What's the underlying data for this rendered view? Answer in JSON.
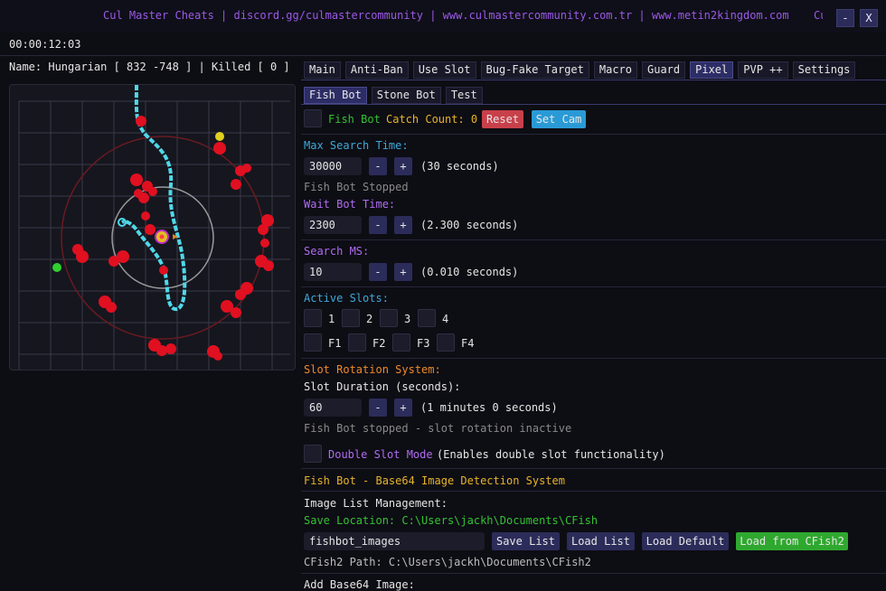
{
  "window": {
    "title": "Cul Master Cheats | discord.gg/culmastercommunity | www.culmastercommunity.com.tr | www.metin2kingdom.com",
    "title_cut": "Cu",
    "minimize_label": "-",
    "close_label": "X"
  },
  "timer": "00:00:12:03",
  "player_line": "Name: Hungarian [ 832 -748 ] | Killed [ 0 ]",
  "main_tabs": [
    "Main",
    "Anti-Ban",
    "Use Slot",
    "Bug-Fake Target",
    "Macro",
    "Guard",
    "Pixel",
    "PVP ++",
    "Settings"
  ],
  "main_tab_active": "Pixel",
  "sub_tabs": [
    "Fish Bot",
    "Stone Bot",
    "Test"
  ],
  "sub_tab_active": "Fish Bot",
  "fishbot": {
    "toggle_label": "Fish Bot",
    "catch_label": "Catch Count: 0",
    "reset_label": "Reset",
    "setcam_label": "Set Cam",
    "max_search_label": "Max Search Time:",
    "max_search_value": "30000",
    "max_search_hint": "(30 seconds)",
    "status": "Fish Bot Stopped",
    "wait_label": "Wait Bot Time:",
    "wait_value": "2300",
    "wait_hint": "(2.300 seconds)",
    "search_ms_label": "Search MS:",
    "search_ms_value": "10",
    "search_ms_hint": "(0.010 seconds)",
    "minus": "-",
    "plus": "+"
  },
  "slots": {
    "label": "Active Slots:",
    "row1": [
      "1",
      "2",
      "3",
      "4"
    ],
    "row2": [
      "F1",
      "F2",
      "F3",
      "F4"
    ]
  },
  "rotation": {
    "title": "Slot Rotation System:",
    "duration_label": "Slot Duration (seconds):",
    "duration_value": "60",
    "duration_hint": "(1 minutes 0 seconds)",
    "status": "Fish Bot stopped - slot rotation inactive",
    "double_label": "Double Slot Mode",
    "double_hint": "(Enables double slot functionality)"
  },
  "base64": {
    "title": "Fish Bot - Base64 Image Detection System",
    "list_mgmt_label": "Image List Management:",
    "save_location": "Save Location: C:\\Users\\jackh\\Documents\\CFish",
    "list_name": "fishbot_images",
    "save_list": "Save List",
    "load_list": "Load List",
    "load_default": "Load Default",
    "load_cfish2": "Load from CFish2",
    "cfish2_path": "CFish2 Path: C:\\Users\\jackh\\Documents\\CFish2",
    "add_label": "Add Base64 Image:"
  },
  "colors": {
    "accent": "#2d2d66",
    "blue_label": "#3fa9d8",
    "purple_label": "#b06cf0",
    "green_label": "#34c232",
    "reset_button": "#c8404a",
    "setcam_button": "#2a9ad6",
    "load_cfish2_button": "#2fa82f",
    "enemy_marker": "#e01020",
    "path": "#4fd8e8"
  }
}
